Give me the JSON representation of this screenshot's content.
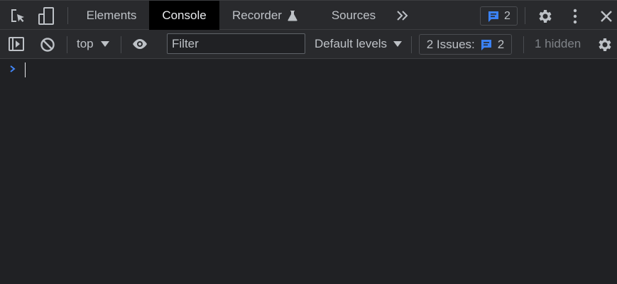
{
  "tabbar": {
    "tabs": [
      {
        "label": "Elements",
        "active": false
      },
      {
        "label": "Console",
        "active": true
      },
      {
        "label": "Recorder",
        "active": false
      },
      {
        "label": "Sources",
        "active": false
      }
    ],
    "messages_badge": "2",
    "icons": {
      "inspect": "inspect-element-icon",
      "device": "device-toolbar-icon",
      "more_tabs": "more-tabs-chevron-icon",
      "recorder_flask": "experimental-flask-icon",
      "messages": "message-icon",
      "settings": "gear-icon",
      "menu": "kebab-menu-icon",
      "close": "close-icon"
    }
  },
  "toolbar": {
    "context": "top",
    "filter_placeholder": "Filter",
    "levels_label": "Default levels",
    "issues_label": "2 Issues:",
    "issues_count": "2",
    "hidden_label": "1 hidden",
    "icons": {
      "sidebar": "show-sidebar-icon",
      "clear": "clear-console-icon",
      "eye": "live-expression-eye-icon",
      "settings": "gear-icon"
    }
  },
  "colors": {
    "background": "#202124",
    "toolbar_background": "#292a2d",
    "active_tab": "#000000",
    "text": "#bdc1c6",
    "accent_blue": "#3b82f6",
    "prompt_blue": "#4285f4"
  }
}
